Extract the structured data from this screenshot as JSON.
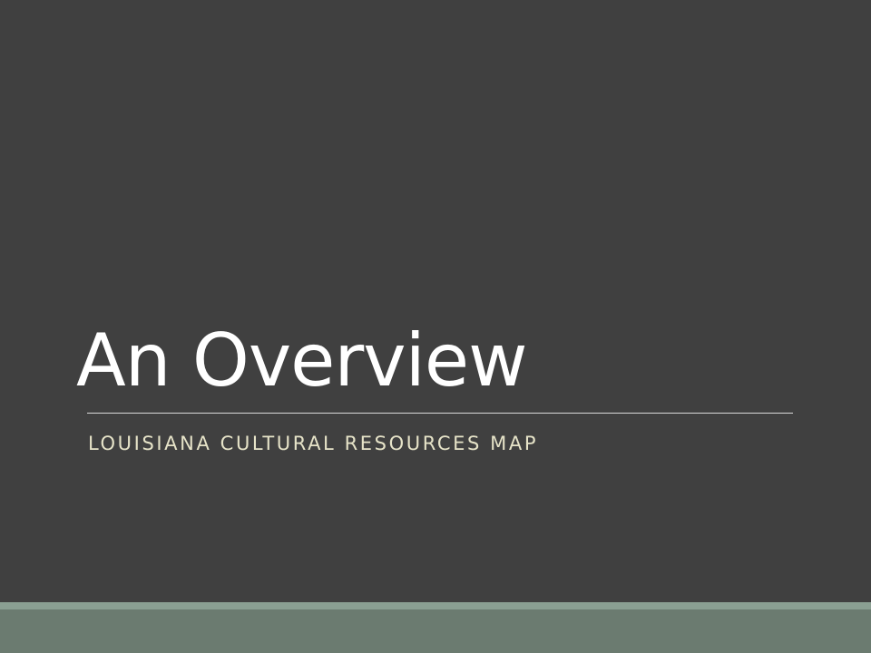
{
  "slide": {
    "title": "An Overview",
    "subtitle": "LOUISIANA CULTURAL RESOURCES MAP"
  },
  "colors": {
    "background": "#404040",
    "title_text": "#ffffff",
    "subtitle_text": "#e6e3c8",
    "rule": "#d9d9d9",
    "footer_band": "#6b7b70",
    "footer_band_light": "#8a9f92"
  }
}
